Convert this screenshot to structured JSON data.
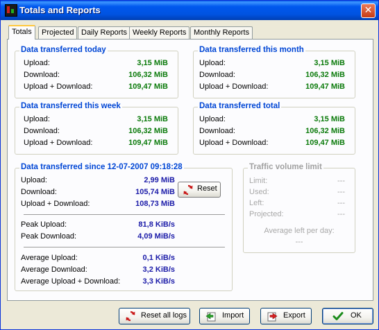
{
  "window": {
    "title": "Totals and Reports",
    "close": "✕"
  },
  "tabs": [
    "Totals",
    "Projected",
    "Daily Reports",
    "Weekly Reports",
    "Monthly Reports"
  ],
  "today": {
    "title": "Data transferred today",
    "upload_label": "Upload:",
    "upload": "3,15 MiB",
    "download_label": "Download:",
    "download": "106,32 MiB",
    "total_label": "Upload + Download:",
    "total": "109,47 MiB"
  },
  "month": {
    "title": "Data transferred this month",
    "upload_label": "Upload:",
    "upload": "3,15 MiB",
    "download_label": "Download:",
    "download": "106,32 MiB",
    "total_label": "Upload + Download:",
    "total": "109,47 MiB"
  },
  "week": {
    "title": "Data transferred this week",
    "upload_label": "Upload:",
    "upload": "3,15 MiB",
    "download_label": "Download:",
    "download": "106,32 MiB",
    "total_label": "Upload + Download:",
    "total": "109,47 MiB"
  },
  "total": {
    "title": "Data transferred total",
    "upload_label": "Upload:",
    "upload": "3,15 MiB",
    "download_label": "Download:",
    "download": "106,32 MiB",
    "total_label": "Upload + Download:",
    "total": "109,47 MiB"
  },
  "since": {
    "title": "Data transferred since 12-07-2007 09:18:28",
    "upload_label": "Upload:",
    "upload": "2,99 MiB",
    "download_label": "Download:",
    "download": "105,74 MiB",
    "total_label": "Upload + Download:",
    "total": "108,73 MiB",
    "peak_upload_label": "Peak Upload:",
    "peak_upload": "81,8 KiB/s",
    "peak_download_label": "Peak Download:",
    "peak_download": "4,09 MiB/s",
    "avg_upload_label": "Average Upload:",
    "avg_upload": "0,1 KiB/s",
    "avg_download_label": "Average Download:",
    "avg_download": "3,2 KiB/s",
    "avg_total_label": "Average Upload + Download:",
    "avg_total": "3,3 KiB/s",
    "reset_label": "Reset"
  },
  "limit": {
    "title": "Traffic volume limit",
    "limit_label": "Limit:",
    "limit": "---",
    "used_label": "Used:",
    "used": "---",
    "left_label": "Left:",
    "left": "---",
    "projected_label": "Projected:",
    "projected": "---",
    "avg_left_label": "Average left per day:",
    "avg_left": "---"
  },
  "buttons": {
    "reset_all": "Reset all logs",
    "import": "Import",
    "export": "Export",
    "ok": "OK"
  },
  "colors": {
    "title_bar": "#0058ee",
    "group_title": "#0046d5",
    "value_green": "#0a7a0a",
    "value_blue": "#1a1aa8"
  },
  "icons": {
    "app": "app-icon",
    "close": "close-icon",
    "reset": "refresh-icon",
    "import": "import-icon",
    "export": "export-icon",
    "ok": "checkmark-icon"
  }
}
